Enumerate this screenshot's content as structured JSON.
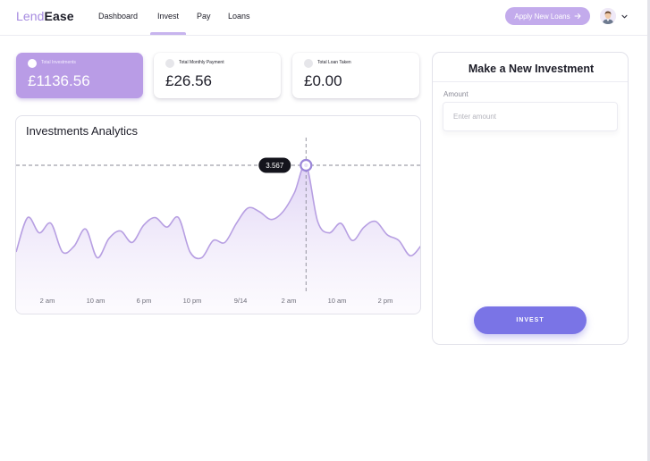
{
  "brand": {
    "part1": "Lend",
    "part2": "Ease"
  },
  "nav": [
    {
      "label": "Dashboard",
      "active": false
    },
    {
      "label": "Invest",
      "active": true
    },
    {
      "label": "Pay",
      "active": false
    },
    {
      "label": "Loans",
      "active": false
    }
  ],
  "header": {
    "apply_label": "Apply New Loans",
    "apply_icon": "arrow-right-icon",
    "avatar_icon": "user-avatar",
    "menu_icon": "chevron-down-icon"
  },
  "stats": [
    {
      "label": "Total Investments",
      "value": "£1136.56",
      "active": true
    },
    {
      "label": "Total Monthly Payment",
      "value": "£26.56",
      "active": false
    },
    {
      "label": "Total Loan Taken",
      "value": "£0.00",
      "active": false
    }
  ],
  "analytics": {
    "title": "Investments Analytics"
  },
  "chart_data": {
    "type": "area",
    "title": "Investments Analytics",
    "x_labels": [
      "2 am",
      "10 am",
      "6 pm",
      "10 pm",
      "9/14",
      "2 am",
      "10 am",
      "2 pm"
    ],
    "highlight": {
      "label": "3.567",
      "index": 25
    },
    "values": [
      1.3,
      2.2,
      1.8,
      2.05,
      1.3,
      1.45,
      1.9,
      1.15,
      1.65,
      1.85,
      1.55,
      2.0,
      2.2,
      1.95,
      2.2,
      1.3,
      1.15,
      1.6,
      1.55,
      2.05,
      2.45,
      2.35,
      2.15,
      2.35,
      2.85,
      3.567,
      2.1,
      1.8,
      2.05,
      1.6,
      1.95,
      2.1,
      1.75,
      1.6,
      1.2,
      1.5
    ]
  },
  "colors": {
    "accent": "#b99ce6",
    "button": "#7a74e6",
    "line": "#b79fe2"
  },
  "invest_form": {
    "title": "Make a New Investment",
    "amount_label": "Amount",
    "amount_placeholder": "Enter amount",
    "amount_value": "",
    "button_label": "INVEST"
  }
}
